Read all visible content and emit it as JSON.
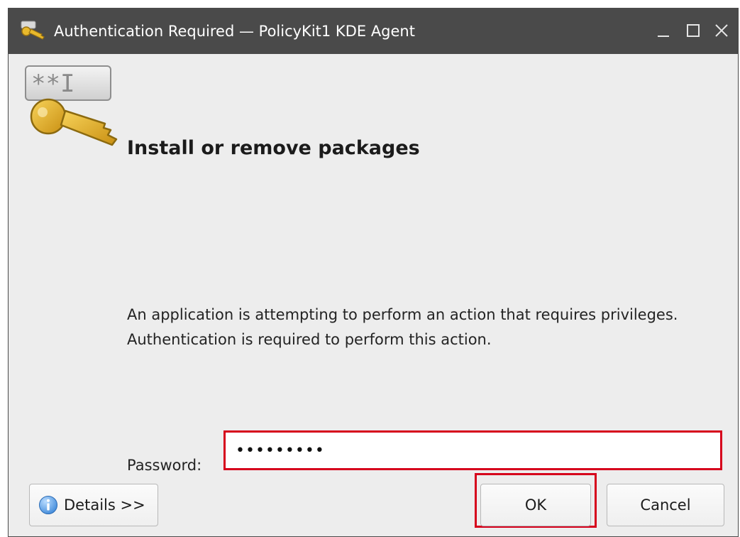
{
  "window": {
    "title": "Authentication Required — PolicyKit1 KDE Agent",
    "controls": {
      "minimize_icon": "minimize-icon",
      "maximize_icon": "maximize-icon",
      "close_icon": "close-icon"
    }
  },
  "dialog": {
    "icon": "password-key-icon",
    "icon_text": "**I",
    "heading": "Install or remove packages",
    "message": "An application is attempting to perform an action that requires privileges. Authentication is required to perform this action.",
    "password_label": "Password:",
    "password_value": "•••••••••",
    "highlight_color": "#d6001c"
  },
  "buttons": {
    "details_label": "Details >>",
    "details_icon": "info-icon",
    "ok_label": "OK",
    "cancel_label": "Cancel"
  }
}
